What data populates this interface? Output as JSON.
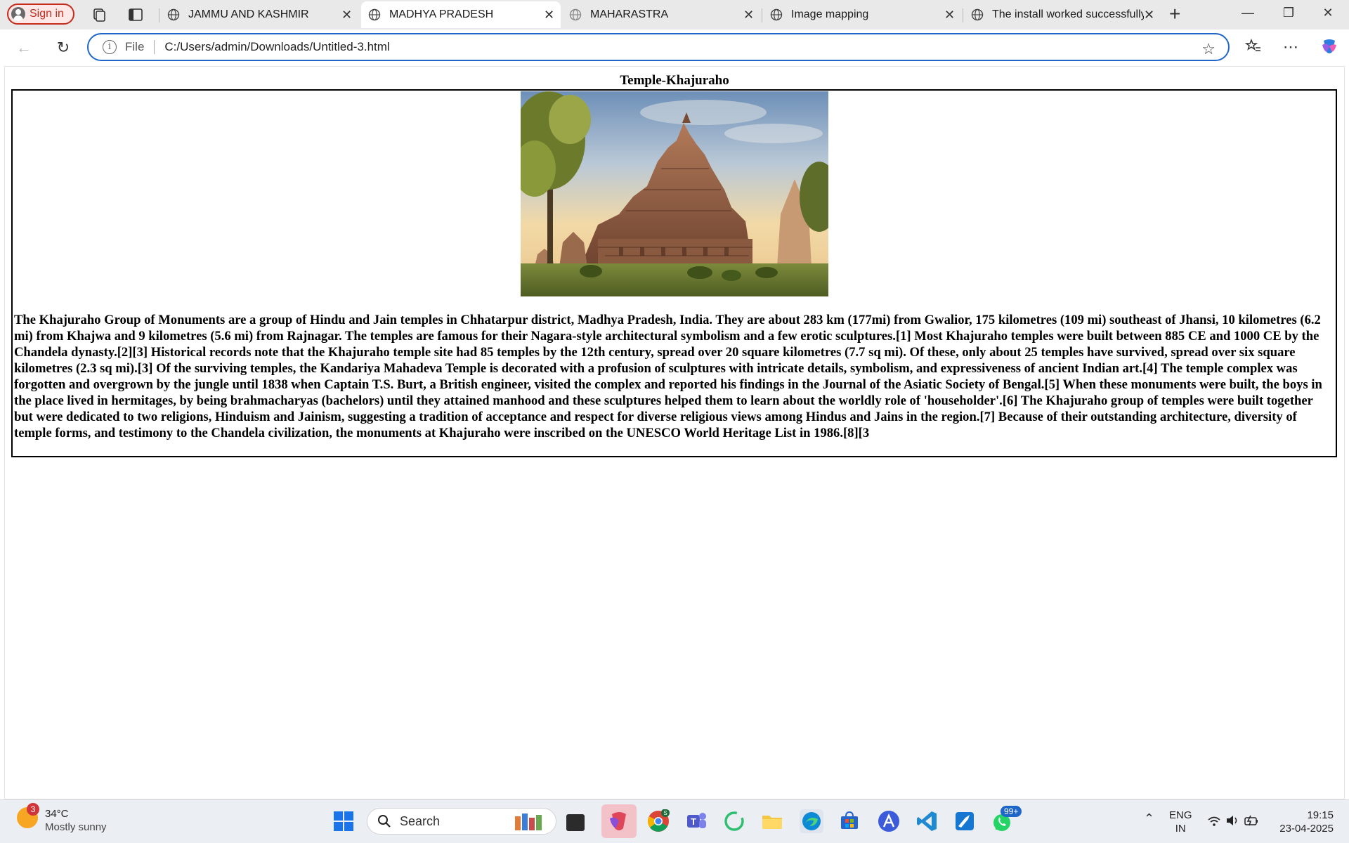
{
  "browser": {
    "signin_label": "Sign in",
    "tabs": [
      {
        "title": "JAMMU AND KASHMIR",
        "active": false
      },
      {
        "title": "MADHYA PRADESH",
        "active": true
      },
      {
        "title": "MAHARASTRA",
        "active": false
      },
      {
        "title": "Image mapping",
        "active": false
      },
      {
        "title": "The install worked successfully!",
        "active": false
      }
    ],
    "address": {
      "scheme": "File",
      "url": "C:/Users/admin/Downloads/Untitled-3.html"
    },
    "accent": "#1f66c9"
  },
  "page": {
    "heading": "Temple-Khajuraho",
    "image_alt": "Khajuraho temple photograph",
    "paragraph": "The Khajuraho Group of Monuments are a group of Hindu and Jain temples in Chhatarpur district, Madhya Pradesh, India. They are about 283 km (177mi) from Gwalior, 175 kilometres (109 mi) southeast of Jhansi, 10 kilometres (6.2 mi) from Khajwa and 9 kilometres (5.6 mi) from Rajnagar. The temples are famous for their Nagara-style architectural symbolism and a few erotic sculptures.[1] Most Khajuraho temples were built between 885 CE and 1000 CE by the Chandela dynasty.[2][3] Historical records note that the Khajuraho temple site had 85 temples by the 12th century, spread over 20 square kilometres (7.7 sq mi). Of these, only about 25 temples have survived, spread over six square kilometres (2.3 sq mi).[3] Of the surviving temples, the Kandariya Mahadeva Temple is decorated with a profusion of sculptures with intricate details, symbolism, and expressiveness of ancient Indian art.[4] The temple complex was forgotten and overgrown by the jungle until 1838 when Captain T.S. Burt, a British engineer, visited the complex and reported his findings in the Journal of the Asiatic Society of Bengal.[5] When these monuments were built, the boys in the place lived in hermitages, by being brahmacharyas (bachelors) until they attained manhood and these sculptures helped them to learn about the worldly role of 'householder'.[6] The Khajuraho group of temples were built together but were dedicated to two religions, Hinduism and Jainism, suggesting a tradition of acceptance and respect for diverse religious views among Hindus and Jains in the region.[7] Because of their outstanding architecture, diversity of temple forms, and testimony to the Chandela civilization, the monuments at Khajuraho were inscribed on the UNESCO World Heritage List in 1986.[8][3"
  },
  "taskbar": {
    "weather": {
      "temp": "34°C",
      "condition": "Mostly sunny",
      "badge": "3"
    },
    "search_label": "Search",
    "whatsapp_badge": "99+",
    "teams_badge": "S",
    "lang": "ENG",
    "region": "IN",
    "time": "19:15",
    "date": "23-04-2025"
  }
}
